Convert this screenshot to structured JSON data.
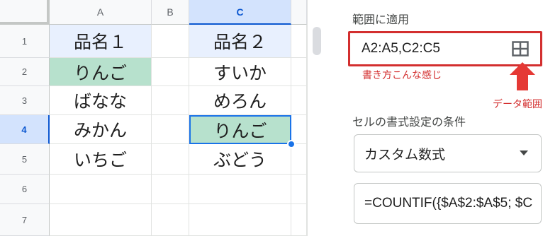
{
  "sheet": {
    "columns": [
      "A",
      "B",
      "C"
    ],
    "rows": [
      "1",
      "2",
      "3",
      "4",
      "5",
      "6",
      "7"
    ],
    "cells": {
      "A1": "品名１",
      "C1": "品名２",
      "A2": "りんご",
      "C2": "すいか",
      "A3": "ばなな",
      "C3": "めろん",
      "A4": "みかん",
      "C4": "りんご",
      "A5": "いちご",
      "C5": "ぶどう"
    },
    "colors": {
      "header_highlight": "#e8f0fe",
      "match_highlight": "#b7e1cd",
      "selection": "#1a73e8"
    }
  },
  "panel": {
    "apply_to_range_label": "範囲に適用",
    "range_value": "A2:A5,C2:C5",
    "range_icon": "grid-select-icon",
    "annotation_example": "書き方こんな感じ",
    "annotation_data_range": "データ範囲",
    "conditions_label": "セルの書式設定の条件",
    "condition_type": "カスタム数式",
    "formula_value": "=COUNTIF({$A$2:$A$5; $C",
    "annotation_color": "#d32f2f"
  }
}
